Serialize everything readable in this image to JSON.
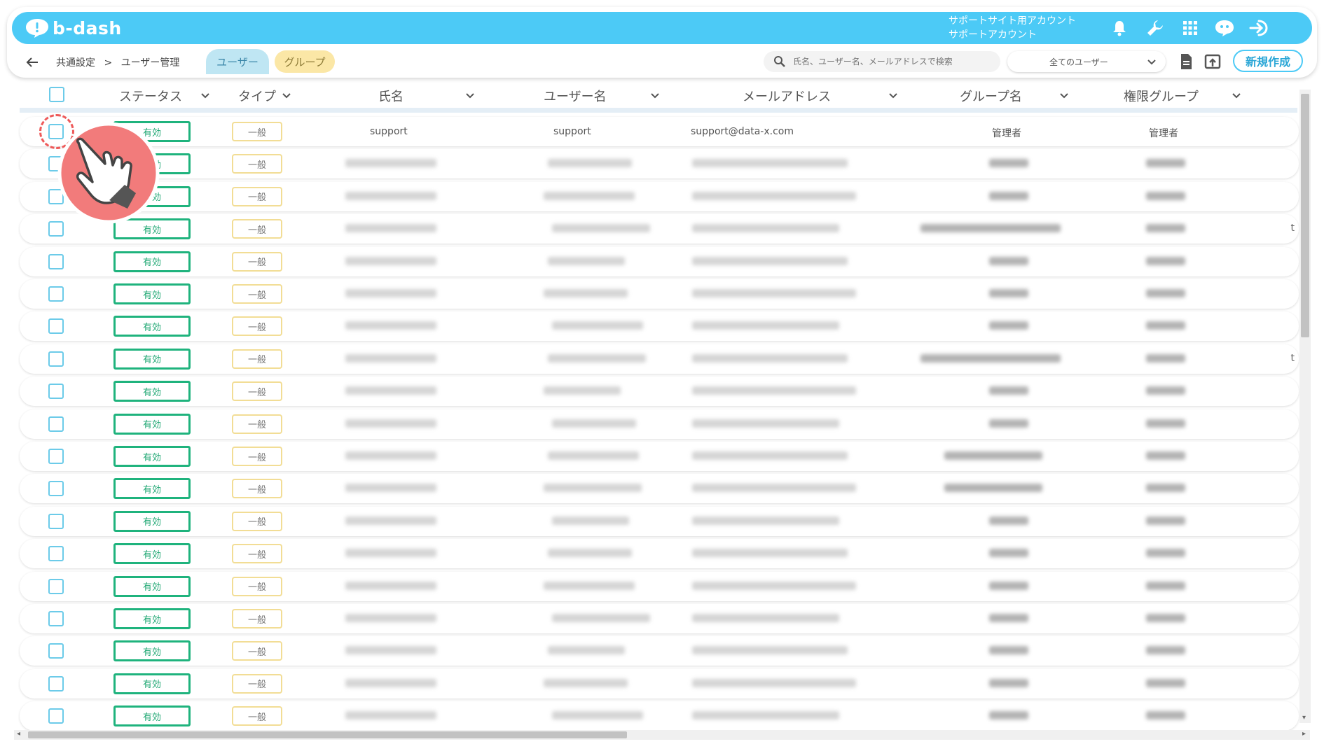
{
  "header": {
    "logo_text": "b-dash",
    "account_line1": "サポートサイト用アカウント",
    "account_line2": "サポートアカウント",
    "icons": [
      "bell-icon",
      "wrench-icon",
      "grid-icon",
      "chat-robot-icon",
      "logout-icon"
    ]
  },
  "nav": {
    "breadcrumb_parent": "共通設定",
    "breadcrumb_sep": ">",
    "breadcrumb_current": "ユーザー管理",
    "tabs": [
      {
        "label": "ユーザー",
        "active": true
      },
      {
        "label": "グループ",
        "active": false
      }
    ],
    "search_placeholder": "氏名、ユーザー名、メールアドレスで検索",
    "filter_value": "全てのユーザー",
    "new_button": "新規作成"
  },
  "table": {
    "columns": [
      "ステータス",
      "タイプ",
      "氏名",
      "ユーザー名",
      "メールアドレス",
      "グループ名",
      "権限グループ"
    ],
    "first_row": {
      "status": "有効",
      "type": "一般",
      "name": "support",
      "username": "support",
      "email": "support@data-x.com",
      "group": "管理者",
      "role": "管理者"
    },
    "status_label": "有効",
    "type_label": "一般",
    "row_count": 19
  },
  "colors": {
    "accent": "#4ccaf6",
    "status_green": "#1fb37d",
    "type_border": "#f2dd95",
    "hint_red": "#ee5a5a"
  }
}
